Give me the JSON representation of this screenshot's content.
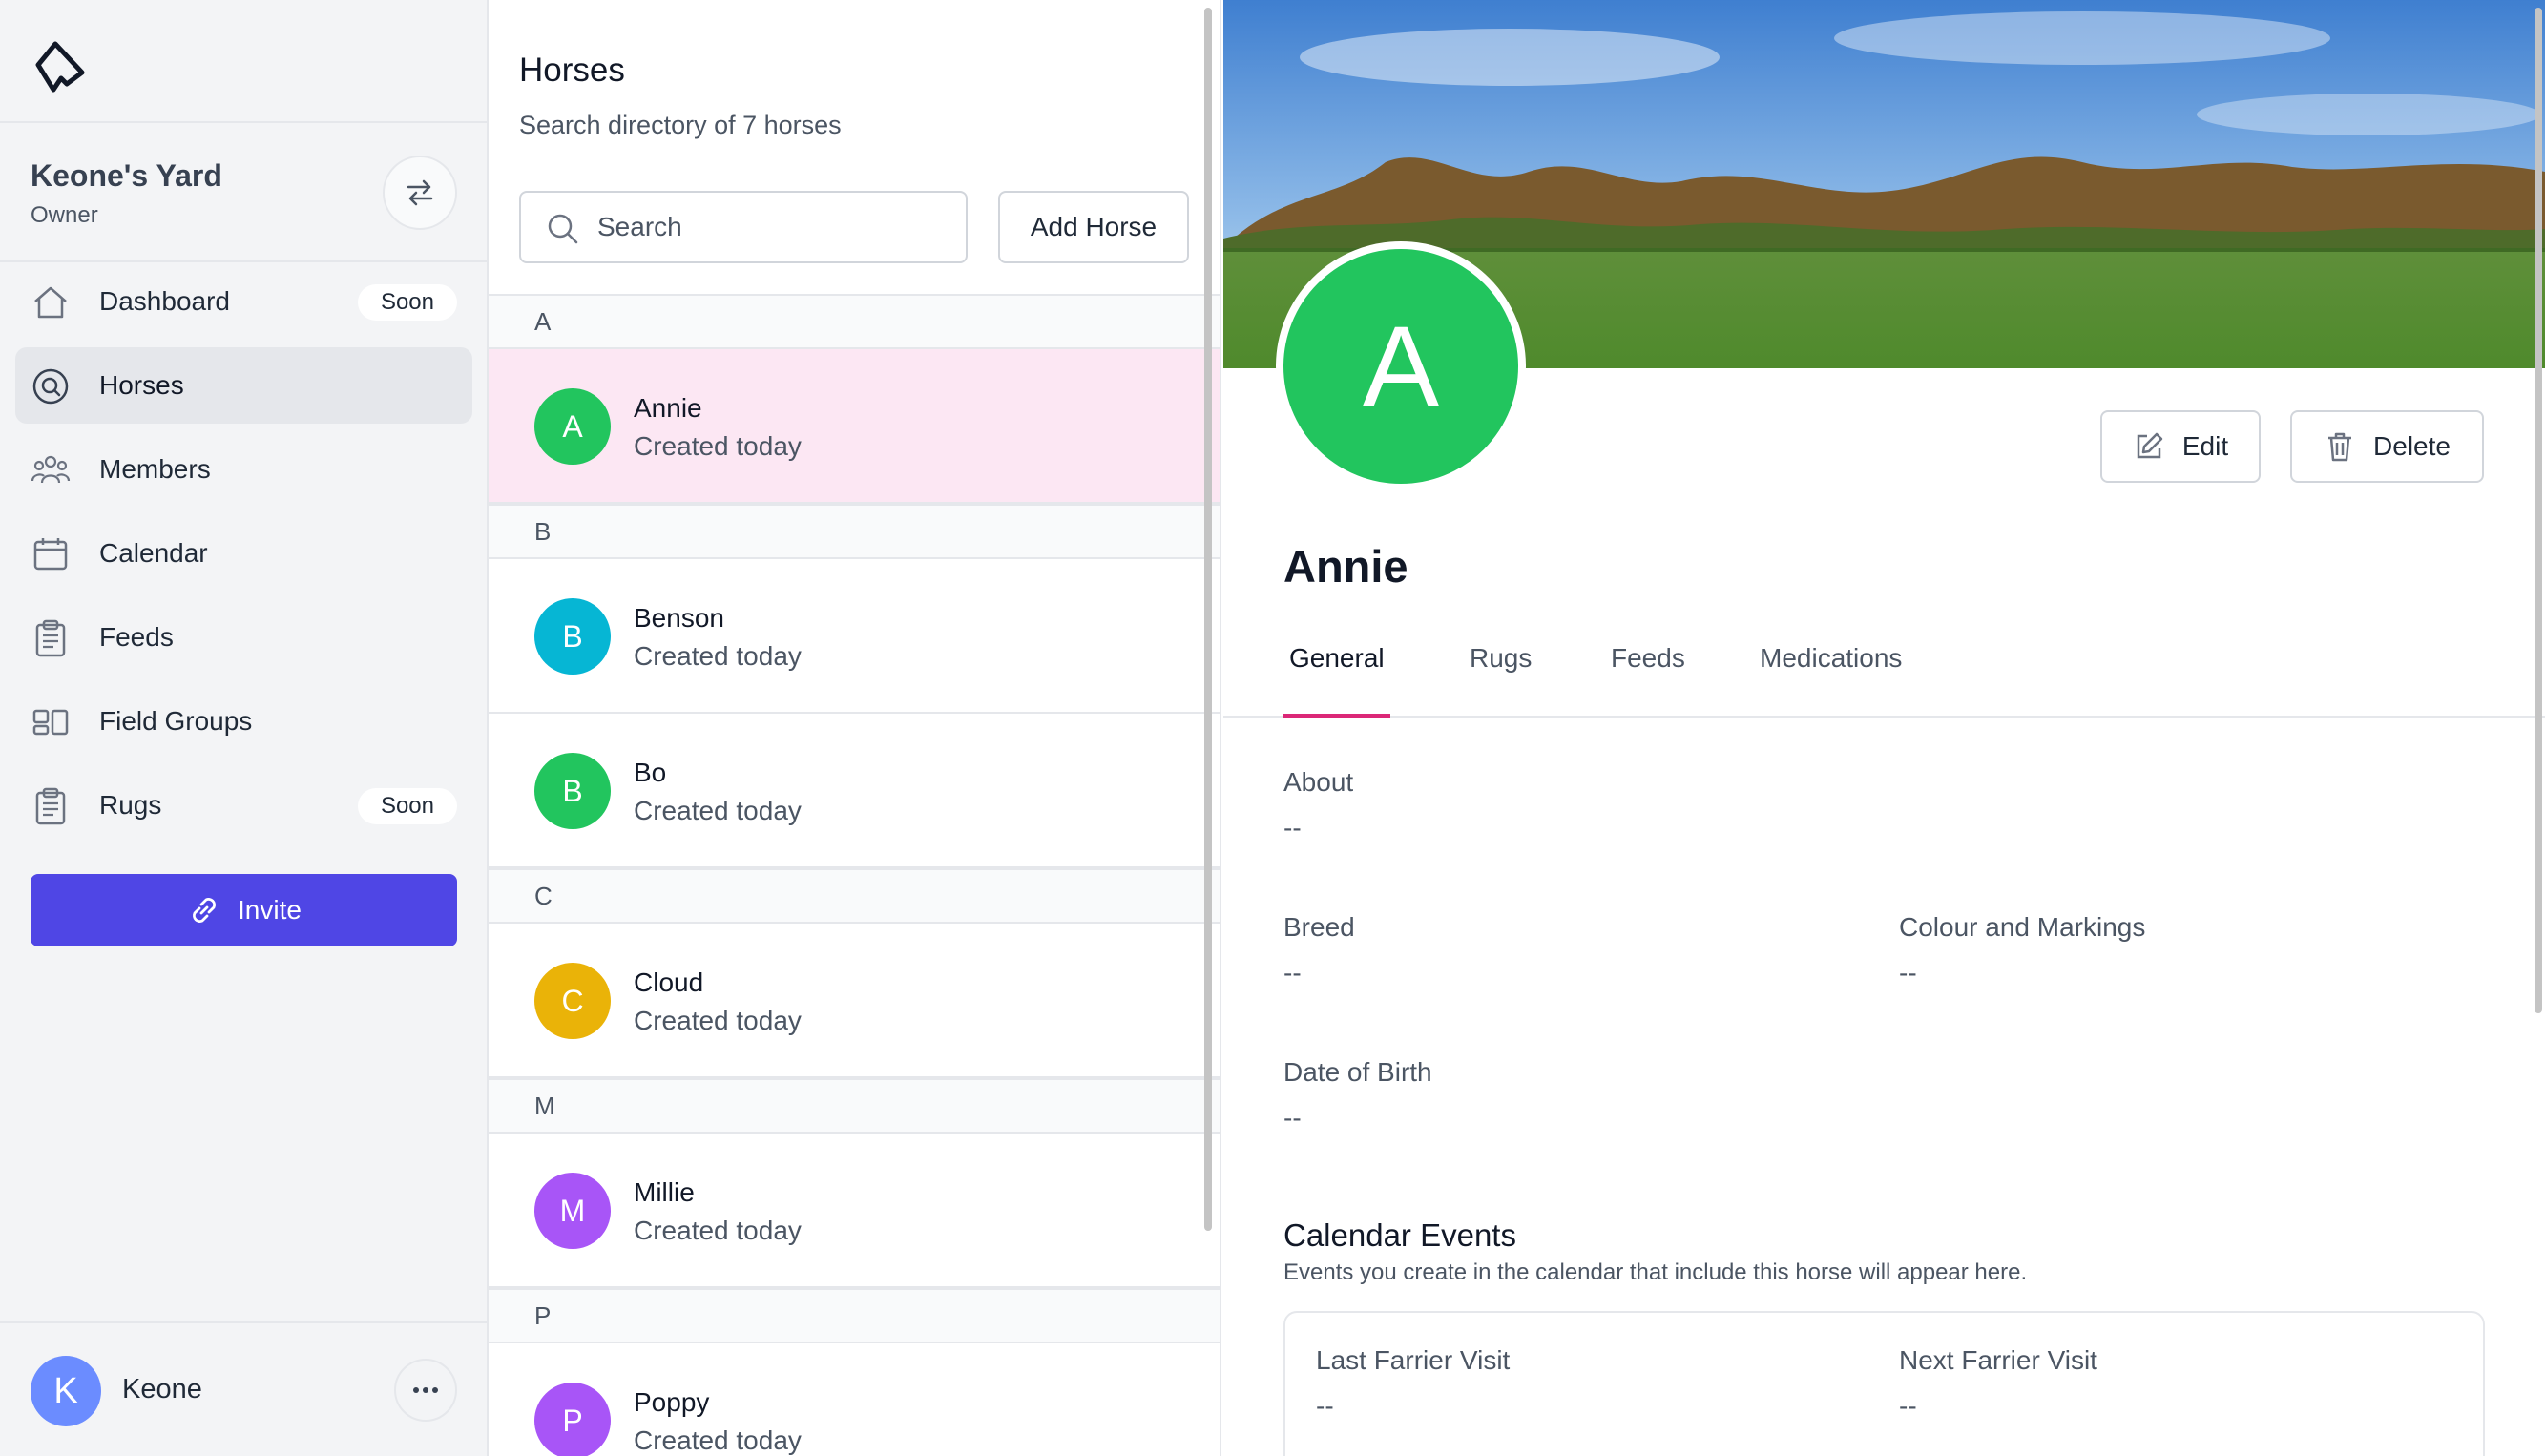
{
  "sidebar": {
    "yard_name": "Keone's Yard",
    "yard_role": "Owner",
    "nav": [
      {
        "label": "Dashboard",
        "badge": "Soon",
        "icon": "home-icon"
      },
      {
        "label": "Horses",
        "icon": "horse-search-icon",
        "active": true
      },
      {
        "label": "Members",
        "icon": "users-icon"
      },
      {
        "label": "Calendar",
        "icon": "calendar-icon"
      },
      {
        "label": "Feeds",
        "icon": "clipboard-icon"
      },
      {
        "label": "Field Groups",
        "icon": "field-groups-icon"
      },
      {
        "label": "Rugs",
        "badge": "Soon",
        "icon": "clipboard-icon"
      }
    ],
    "invite_label": "Invite",
    "user": {
      "initial": "K",
      "name": "Keone"
    }
  },
  "list": {
    "title": "Horses",
    "subtitle": "Search directory of 7 horses",
    "search_placeholder": "Search",
    "add_label": "Add Horse",
    "groups": [
      {
        "letter": "A",
        "horses": [
          {
            "initial": "A",
            "name": "Annie",
            "created": "Created today",
            "color": "#22c55e",
            "selected": true
          }
        ]
      },
      {
        "letter": "B",
        "horses": [
          {
            "initial": "B",
            "name": "Benson",
            "created": "Created today",
            "color": "#06b6d4"
          },
          {
            "initial": "B",
            "name": "Bo",
            "created": "Created today",
            "color": "#22c55e"
          }
        ]
      },
      {
        "letter": "C",
        "horses": [
          {
            "initial": "C",
            "name": "Cloud",
            "created": "Created today",
            "color": "#eab308"
          }
        ]
      },
      {
        "letter": "M",
        "horses": [
          {
            "initial": "M",
            "name": "Millie",
            "created": "Created today",
            "color": "#a855f7"
          }
        ]
      },
      {
        "letter": "P",
        "horses": [
          {
            "initial": "P",
            "name": "Poppy",
            "created": "Created today",
            "color": "#a855f7"
          }
        ]
      }
    ]
  },
  "detail": {
    "avatar_initial": "A",
    "avatar_color": "#22c55e",
    "name": "Annie",
    "edit_label": "Edit",
    "delete_label": "Delete",
    "tabs": [
      "General",
      "Rugs",
      "Feeds",
      "Medications"
    ],
    "active_tab": "General",
    "fields": {
      "about": {
        "label": "About",
        "value": "--"
      },
      "breed": {
        "label": "Breed",
        "value": "--"
      },
      "colour": {
        "label": "Colour and Markings",
        "value": "--"
      },
      "dob": {
        "label": "Date of Birth",
        "value": "--"
      }
    },
    "events": {
      "title": "Calendar Events",
      "subtitle": "Events you create in the calendar that include this horse will appear here.",
      "last_farrier": {
        "label": "Last Farrier Visit",
        "value": "--"
      },
      "next_farrier": {
        "label": "Next Farrier Visit",
        "value": "--"
      }
    }
  },
  "colors": {
    "accent": "#4f46e5",
    "tab_indicator": "#db2777",
    "selected_row": "#fce7f3"
  }
}
